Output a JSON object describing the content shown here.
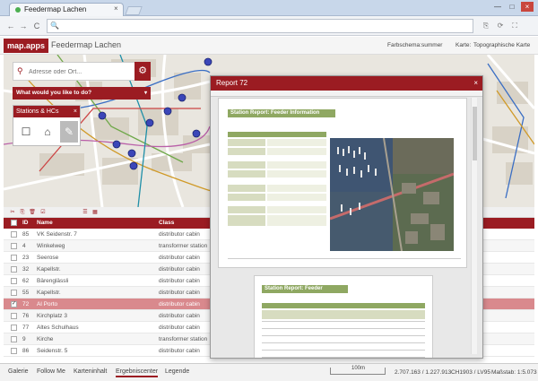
{
  "browser": {
    "tab_title": "Feedermap Lachen",
    "close_glyph": "×",
    "win_min": "—",
    "win_max": "□",
    "win_close": "×",
    "back_glyph": "←",
    "forward_glyph": "→",
    "reload_glyph": "C",
    "url": ""
  },
  "app": {
    "logo": "map.apps",
    "name": "Feedermap Lachen",
    "farbschema_label": "Farbschema:",
    "farbschema_value": "summer",
    "karte_label": "Karte:",
    "karte_value": "Topographische Karte"
  },
  "search": {
    "placeholder": "Adresse oder Ort...",
    "pin_glyph": "⚲",
    "gear_glyph": "⚙"
  },
  "wywd": {
    "label": "What would you like to do?",
    "caret": "▾"
  },
  "stations": {
    "title": "Stations & HCs",
    "close_glyph": "×",
    "buttons": [
      "☐",
      "⌂",
      "✎"
    ]
  },
  "grid": {
    "toolbar_icons": [
      "✂",
      "⎘",
      "🗑",
      "☑",
      "☰",
      "▦"
    ],
    "columns": {
      "id": "ID",
      "name": "Name",
      "class": "Class"
    },
    "rows": [
      {
        "checked": false,
        "id": "85",
        "name": "VK Seidenstr. 7",
        "class": "distributor cabin"
      },
      {
        "checked": false,
        "id": "4",
        "name": "Winkelweg",
        "class": "transformer station"
      },
      {
        "checked": false,
        "id": "23",
        "name": "Seerose",
        "class": "distributor cabin"
      },
      {
        "checked": false,
        "id": "32",
        "name": "Kapellstr.",
        "class": "distributor cabin"
      },
      {
        "checked": false,
        "id": "62",
        "name": "Bärenglässli",
        "class": "distributor cabin"
      },
      {
        "checked": false,
        "id": "55",
        "name": "Kapellstr.",
        "class": "distributor cabin"
      },
      {
        "checked": true,
        "id": "72",
        "name": "Al Porto",
        "class": "distributor cabin"
      },
      {
        "checked": false,
        "id": "76",
        "name": "Kirchplatz 3",
        "class": "distributor cabin"
      },
      {
        "checked": false,
        "id": "77",
        "name": "Altes Schulhaus",
        "class": "distributor cabin"
      },
      {
        "checked": false,
        "id": "9",
        "name": "Kirche",
        "class": "transformer station"
      },
      {
        "checked": false,
        "id": "86",
        "name": "Seidenstr. 5",
        "class": "distributor cabin"
      }
    ]
  },
  "report": {
    "title": "Report 72",
    "close_glyph": "×",
    "banner1": "Station Report: Feeder Information",
    "banner2": "Station Report: Feeder Information"
  },
  "footer": {
    "tabs": [
      "Galerie",
      "Follow Me",
      "Karteninhalt",
      "Ergebniscenter",
      "Legende"
    ],
    "active_tab": "Ergebniscenter",
    "scale": "100m",
    "coords": "2.707.163 / 1.227.913",
    "crs": "CH1903 / LV95",
    "scale_label": "Maßstab: 1:5.073"
  },
  "colors": {
    "accent": "#9b1c22",
    "report_green": "#8fa862",
    "selected_row": "#d9898d"
  }
}
